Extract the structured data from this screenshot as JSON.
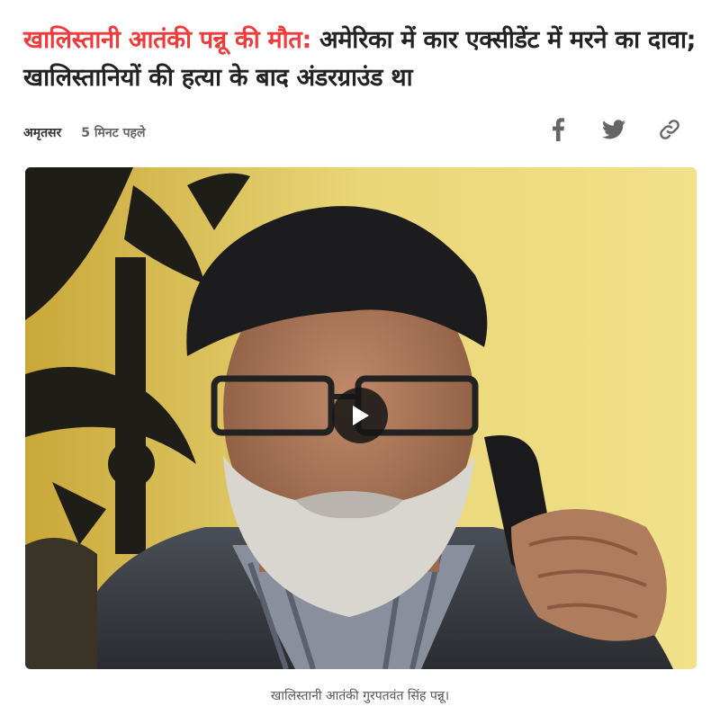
{
  "article": {
    "headline_kicker": "खालिस्तानी आतंकी पन्नू की मौत:",
    "headline_rest": " अमेरिका में कार एक्सीडेंट में मरने का दावा; खालिस्तानियों की हत्या के बाद अंडरग्राउंड था",
    "location": "अमृतसर",
    "time_ago": "5 मिनट पहले"
  },
  "share": {
    "facebook_icon": "facebook-icon",
    "twitter_icon": "twitter-icon",
    "link_icon": "link-icon"
  },
  "media": {
    "type": "video",
    "play_icon": "play-icon",
    "caption": "खालिस्तानी आतंकी गुरपतवंत सिंह पन्नू।"
  },
  "colors": {
    "kicker": "#f03b3b",
    "headline": "#222222",
    "icon": "#666666"
  }
}
